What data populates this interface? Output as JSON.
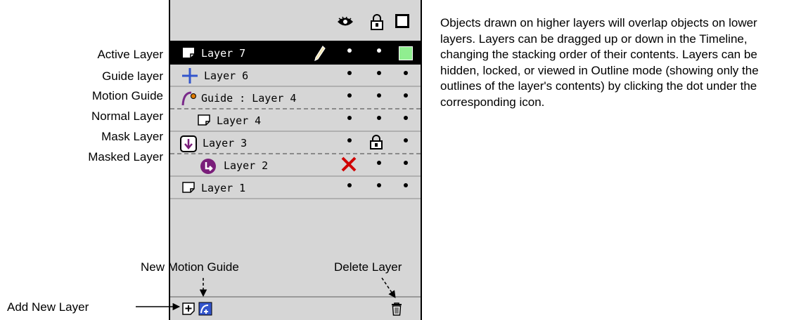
{
  "callouts": {
    "active_layer": "Active Layer",
    "guide_layer": "Guide layer",
    "motion_guide": "Motion Guide",
    "normal_layer": "Normal Layer",
    "mask_layer": "Mask Layer",
    "masked_layer": "Masked Layer"
  },
  "header_icons": [
    "eye-icon",
    "lock-icon",
    "outline-icon"
  ],
  "layers": {
    "layer7": "Layer 7",
    "layer6": "Layer 6",
    "guide4": "Guide : Layer 4",
    "layer4": "Layer 4",
    "layer3": "Layer 3",
    "layer2": "Layer 2",
    "layer1": "Layer 1"
  },
  "annotations": {
    "new_motion_guide": "New Motion Guide",
    "delete_layer": "Delete Layer",
    "add_new_layer": "Add New Layer"
  },
  "description": "Objects drawn on higher layers will overlap objects on lower layers. Layers can be dragged up or down in the Timeline, changing the stacking order of their contents. Layers can be hidden, locked, or viewed in Outline mode (showing only the outlines of the layer's contents) by clicking the dot under the corresponding icon.",
  "colors": {
    "panel_bg": "#d6d6d6",
    "active_row_bg": "#000000",
    "guide_icon": "#3355cc",
    "motion_guide_icon": "#7a2a8a",
    "masked_icon": "#7a1e7a",
    "delete_x": "#d00000",
    "outline_swatch": "#90ee90"
  }
}
